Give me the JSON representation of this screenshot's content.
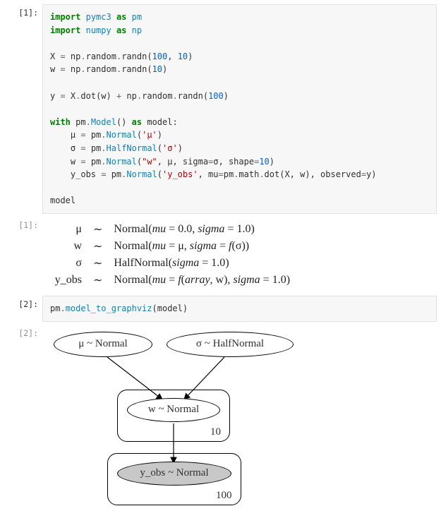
{
  "cells": {
    "c1": {
      "in_prompt": "[1]:",
      "out_prompt": "[1]:",
      "code_tokens": [
        {
          "t": "import",
          "c": "k"
        },
        {
          "t": " "
        },
        {
          "t": "pymc3",
          "c": "nn"
        },
        {
          "t": " "
        },
        {
          "t": "as",
          "c": "k"
        },
        {
          "t": " "
        },
        {
          "t": "pm",
          "c": "nn"
        },
        {
          "t": "\n"
        },
        {
          "t": "import",
          "c": "k"
        },
        {
          "t": " "
        },
        {
          "t": "numpy",
          "c": "nn"
        },
        {
          "t": " "
        },
        {
          "t": "as",
          "c": "k"
        },
        {
          "t": " "
        },
        {
          "t": "np",
          "c": "nn"
        },
        {
          "t": "\n"
        },
        {
          "t": "\n"
        },
        {
          "t": "X "
        },
        {
          "t": "=",
          "c": "pu"
        },
        {
          "t": " np"
        },
        {
          "t": ".",
          "c": "pu"
        },
        {
          "t": "random"
        },
        {
          "t": ".",
          "c": "pu"
        },
        {
          "t": "randn"
        },
        {
          "t": "("
        },
        {
          "t": "100",
          "c": "nu"
        },
        {
          "t": ", "
        },
        {
          "t": "10",
          "c": "nu"
        },
        {
          "t": ")"
        },
        {
          "t": "\n"
        },
        {
          "t": "w "
        },
        {
          "t": "=",
          "c": "pu"
        },
        {
          "t": " np"
        },
        {
          "t": ".",
          "c": "pu"
        },
        {
          "t": "random"
        },
        {
          "t": ".",
          "c": "pu"
        },
        {
          "t": "randn"
        },
        {
          "t": "("
        },
        {
          "t": "10",
          "c": "nu"
        },
        {
          "t": ")"
        },
        {
          "t": "\n"
        },
        {
          "t": "\n"
        },
        {
          "t": "y "
        },
        {
          "t": "=",
          "c": "pu"
        },
        {
          "t": " X"
        },
        {
          "t": ".",
          "c": "pu"
        },
        {
          "t": "dot"
        },
        {
          "t": "(w) "
        },
        {
          "t": "+",
          "c": "pu"
        },
        {
          "t": " np"
        },
        {
          "t": ".",
          "c": "pu"
        },
        {
          "t": "random"
        },
        {
          "t": ".",
          "c": "pu"
        },
        {
          "t": "randn"
        },
        {
          "t": "("
        },
        {
          "t": "100",
          "c": "nu"
        },
        {
          "t": ")"
        },
        {
          "t": "\n"
        },
        {
          "t": "\n"
        },
        {
          "t": "with",
          "c": "k"
        },
        {
          "t": " pm"
        },
        {
          "t": ".",
          "c": "pu"
        },
        {
          "t": "Model",
          "c": "cy"
        },
        {
          "t": "() "
        },
        {
          "t": "as",
          "c": "k"
        },
        {
          "t": " model:"
        },
        {
          "t": "\n"
        },
        {
          "t": "    μ "
        },
        {
          "t": "=",
          "c": "pu"
        },
        {
          "t": " pm"
        },
        {
          "t": ".",
          "c": "pu"
        },
        {
          "t": "Normal",
          "c": "cy"
        },
        {
          "t": "("
        },
        {
          "t": "'μ'",
          "c": "s"
        },
        {
          "t": ")"
        },
        {
          "t": "\n"
        },
        {
          "t": "    σ "
        },
        {
          "t": "=",
          "c": "pu"
        },
        {
          "t": " pm"
        },
        {
          "t": ".",
          "c": "pu"
        },
        {
          "t": "HalfNormal",
          "c": "cy"
        },
        {
          "t": "("
        },
        {
          "t": "'σ'",
          "c": "s"
        },
        {
          "t": ")"
        },
        {
          "t": "\n"
        },
        {
          "t": "    w "
        },
        {
          "t": "=",
          "c": "pu"
        },
        {
          "t": " pm"
        },
        {
          "t": ".",
          "c": "pu"
        },
        {
          "t": "Normal",
          "c": "cy"
        },
        {
          "t": "("
        },
        {
          "t": "\"w\"",
          "c": "s"
        },
        {
          "t": ", μ, sigma"
        },
        {
          "t": "=",
          "c": "pu"
        },
        {
          "t": "σ, shape"
        },
        {
          "t": "=",
          "c": "pu"
        },
        {
          "t": "10",
          "c": "nu"
        },
        {
          "t": ")"
        },
        {
          "t": "\n"
        },
        {
          "t": "    y_obs "
        },
        {
          "t": "=",
          "c": "pu"
        },
        {
          "t": " pm"
        },
        {
          "t": ".",
          "c": "pu"
        },
        {
          "t": "Normal",
          "c": "cy"
        },
        {
          "t": "("
        },
        {
          "t": "'y_obs'",
          "c": "s"
        },
        {
          "t": ", mu"
        },
        {
          "t": "=",
          "c": "pu"
        },
        {
          "t": "pm"
        },
        {
          "t": ".",
          "c": "pu"
        },
        {
          "t": "math"
        },
        {
          "t": ".",
          "c": "pu"
        },
        {
          "t": "dot"
        },
        {
          "t": "(X, w), observed"
        },
        {
          "t": "=",
          "c": "pu"
        },
        {
          "t": "y)"
        },
        {
          "t": "\n"
        },
        {
          "t": "\n"
        },
        {
          "t": "model"
        }
      ],
      "math_rows": [
        {
          "var": "μ",
          "dist": "Normal",
          "params": [
            [
              "mu",
              " = 0.0, "
            ],
            [
              "sigma",
              " = 1.0"
            ]
          ]
        },
        {
          "var": "w",
          "dist": "Normal",
          "params": [
            [
              "mu",
              " = μ, "
            ],
            [
              "sigma",
              " = "
            ],
            [
              "f",
              "(σ)"
            ]
          ]
        },
        {
          "var": "σ",
          "dist": "HalfNormal",
          "params": [
            [
              "sigma",
              " = 1.0"
            ]
          ]
        },
        {
          "var": "y_obs",
          "dist": "Normal",
          "params": [
            [
              "mu",
              " = "
            ],
            [
              "f",
              "("
            ],
            [
              "array",
              ", w), "
            ],
            [
              "sigma",
              " = 1.0"
            ]
          ]
        }
      ]
    },
    "c2": {
      "in_prompt": "[2]:",
      "out_prompt": "[2]:",
      "code_tokens": [
        {
          "t": "pm"
        },
        {
          "t": ".",
          "c": "pu"
        },
        {
          "t": "model_to_graphviz",
          "c": "cy"
        },
        {
          "t": "(model)"
        }
      ],
      "graph": {
        "nodes": {
          "mu": {
            "label": "μ ~ Normal"
          },
          "sigma": {
            "label": "σ ~ HalfNormal"
          },
          "w": {
            "label": "w ~ Normal"
          },
          "yobs": {
            "label": "y_obs ~ Normal"
          }
        },
        "plates": {
          "p10": {
            "label": "10"
          },
          "p100": {
            "label": "100"
          }
        }
      }
    }
  },
  "tilde": "∼"
}
